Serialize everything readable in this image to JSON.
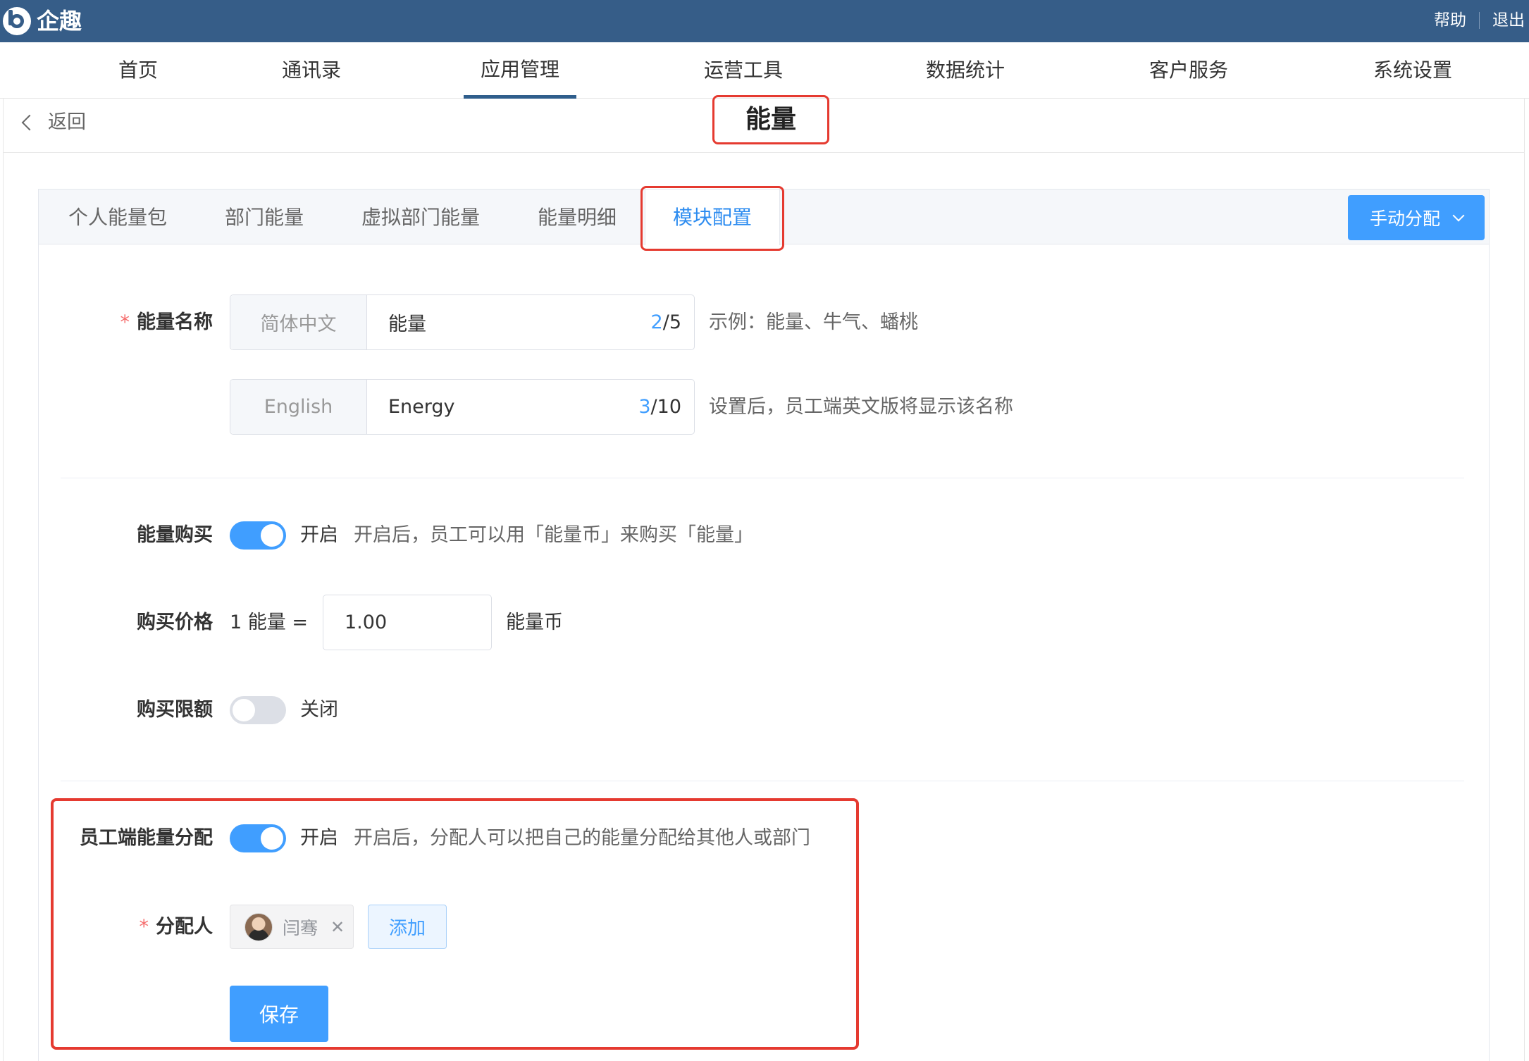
{
  "app": {
    "name": "企趣"
  },
  "top_links": {
    "help": "帮助",
    "logout": "退出"
  },
  "nav": {
    "items": [
      {
        "label": "首页"
      },
      {
        "label": "通讯录"
      },
      {
        "label": "应用管理"
      },
      {
        "label": "运营工具"
      },
      {
        "label": "数据统计"
      },
      {
        "label": "客户服务"
      },
      {
        "label": "系统设置"
      }
    ],
    "active_index": 2
  },
  "page": {
    "back_label": "返回",
    "title": "能量"
  },
  "tabs": {
    "items": [
      {
        "label": "个人能量包"
      },
      {
        "label": "部门能量"
      },
      {
        "label": "虚拟部门能量"
      },
      {
        "label": "能量明细"
      },
      {
        "label": "模块配置"
      }
    ],
    "active_index": 4,
    "action_button": "手动分配"
  },
  "form": {
    "energy_name": {
      "label": "能量名称",
      "zh": {
        "lang": "简体中文",
        "value": "能量",
        "count": "2",
        "max": "/5",
        "hint": "示例：能量、牛气、蟠桃"
      },
      "en": {
        "lang": "English",
        "value": "Energy",
        "count": "3",
        "max": "/10",
        "hint": "设置后，员工端英文版将显示该名称"
      }
    },
    "purchase": {
      "label": "能量购买",
      "enabled": true,
      "state": "开启",
      "hint": "开启后，员工可以用「能量币」来购买「能量」"
    },
    "price": {
      "label": "购买价格",
      "prefix": "1 能量 =",
      "value": "1.00",
      "unit": "能量币"
    },
    "limit": {
      "label": "购买限额",
      "enabled": false,
      "state": "关闭"
    },
    "allocation": {
      "label": "员工端能量分配",
      "enabled": true,
      "state": "开启",
      "hint": "开启后，分配人可以把自己的能量分配给其他人或部门"
    },
    "allocator": {
      "label": "分配人",
      "tag": "闫骞",
      "add": "添加"
    },
    "save": "保存"
  },
  "colors": {
    "topbar": "#365d88",
    "primary": "#409eff",
    "highlight": "#e53a30"
  }
}
